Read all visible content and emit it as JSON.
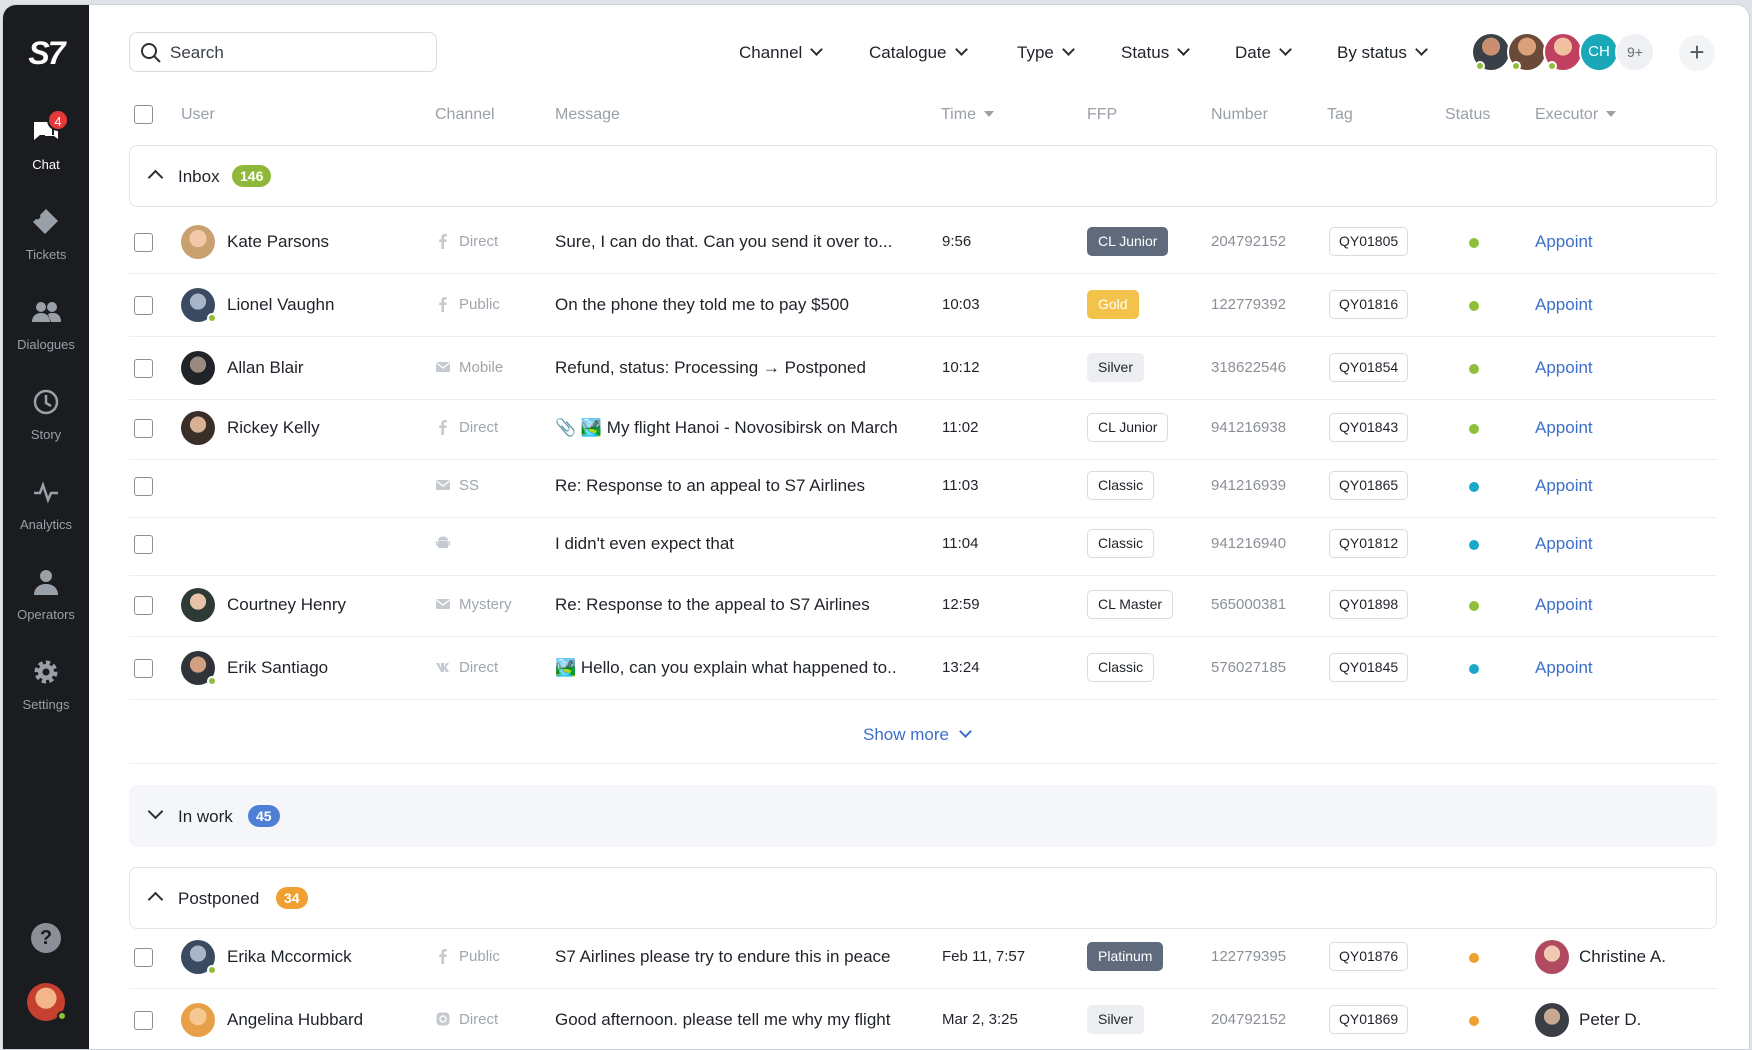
{
  "app": {
    "logo": "S7"
  },
  "sidebar": {
    "items": [
      {
        "label": "Chat",
        "icon": "chat-icon",
        "badge": "4",
        "active": true
      },
      {
        "label": "Tickets",
        "icon": "ticket-icon"
      },
      {
        "label": "Dialogues",
        "icon": "users-icon"
      },
      {
        "label": "Story",
        "icon": "history-icon"
      },
      {
        "label": "Analytics",
        "icon": "pulse-icon"
      },
      {
        "label": "Operators",
        "icon": "user-icon"
      },
      {
        "label": "Settings",
        "icon": "gear-icon"
      }
    ],
    "help": "?"
  },
  "topbar": {
    "search_placeholder": "Search",
    "filters": [
      "Channel",
      "Catalogue",
      "Type",
      "Status",
      "Date",
      "By status"
    ],
    "avatar_initials": "CH",
    "avatar_more": "9+",
    "add": "+"
  },
  "columns": [
    "User",
    "Channel",
    "Message",
    "Time",
    "FFP",
    "Number",
    "Tag",
    "Status",
    "Executor"
  ],
  "groups": {
    "inbox": {
      "title": "Inbox",
      "count": "146",
      "color": "#8fb83a"
    },
    "inwork": {
      "title": "In work",
      "count": "45",
      "color": "#4f7fd6"
    },
    "postponed": {
      "title": "Postponed",
      "count": "34",
      "color": "#f0a030"
    }
  },
  "inbox_rows": [
    {
      "user": "Kate Parsons",
      "channel": "Direct",
      "message": "Sure, I can do that. Can you send it over to...",
      "time": "9:56",
      "ffp": "CL Junior",
      "ffp_style": "dark",
      "number": "204792152",
      "tag": "QY01805",
      "status_color": "#8fbf3a",
      "executor": "Appoint"
    },
    {
      "user": "Lionel Vaughn",
      "channel": "Public",
      "message": "On the phone they told me to pay $500",
      "time": "10:03",
      "ffp": "Gold",
      "ffp_style": "gold",
      "number": "122779392",
      "tag": "QY01816",
      "status_color": "#8fbf3a",
      "executor": "Appoint"
    },
    {
      "user": "Allan Blair",
      "channel": "Mobile",
      "message": "Refund, status: Processing → Postponed",
      "time": "10:12",
      "ffp": "Silver",
      "ffp_style": "silver",
      "number": "318622546",
      "tag": "QY01854",
      "status_color": "#8fbf3a",
      "executor": "Appoint"
    },
    {
      "user": "Rickey Kelly",
      "channel": "Direct",
      "message": "📎 🏞️ My flight Hanoi - Novosibirsk on March",
      "time": "11:02",
      "ffp": "CL Junior",
      "ffp_style": "outline",
      "number": "941216938",
      "tag": "QY01843",
      "status_color": "#8fbf3a",
      "executor": "Appoint"
    },
    {
      "user": "",
      "channel": "SS",
      "message": "Re: Response to an appeal to S7 Airlines",
      "time": "11:03",
      "ffp": "Classic",
      "ffp_style": "outline",
      "number": "941216939",
      "tag": "QY01865",
      "status_color": "#1aa8c8",
      "executor": "Appoint"
    },
    {
      "user": "",
      "channel": "",
      "message": "I didn't even expect that",
      "time": "11:04",
      "ffp": "Classic",
      "ffp_style": "outline",
      "number": "941216940",
      "tag": "QY01812",
      "status_color": "#1aa8c8",
      "executor": "Appoint"
    },
    {
      "user": "Courtney Henry",
      "channel": "Mystery",
      "message": "Re: Response to the appeal to S7 Airlines",
      "time": "12:59",
      "ffp": "CL Master",
      "ffp_style": "outline",
      "number": "565000381",
      "tag": "QY01898",
      "status_color": "#8fbf3a",
      "executor": "Appoint"
    },
    {
      "user": "Erik Santiago",
      "channel": "Direct",
      "message": "🏞️ Hello, can you explain what happened to..",
      "time": "13:24",
      "ffp": "Classic",
      "ffp_style": "outline",
      "number": "576027185",
      "tag": "QY01845",
      "status_color": "#1aa8c8",
      "executor": "Appoint"
    }
  ],
  "show_more": "Show more",
  "postponed_rows": [
    {
      "user": "Erika Mccormick",
      "channel": "Public",
      "message": "S7 Airlines please try to endure this in peace",
      "time": "Feb 11, 7:57",
      "ffp": "Platinum",
      "ffp_style": "dark",
      "number": "122779395",
      "tag": "QY01876",
      "status_color": "#f0a030",
      "executor": "Christine A."
    },
    {
      "user": "Angelina Hubbard",
      "channel": "Direct",
      "message": "Good afternoon. please tell me why my flight",
      "time": "Mar 2, 3:25",
      "ffp": "Silver",
      "ffp_style": "silver",
      "number": "204792152",
      "tag": "QY01869",
      "status_color": "#f0a030",
      "executor": "Peter D."
    }
  ]
}
